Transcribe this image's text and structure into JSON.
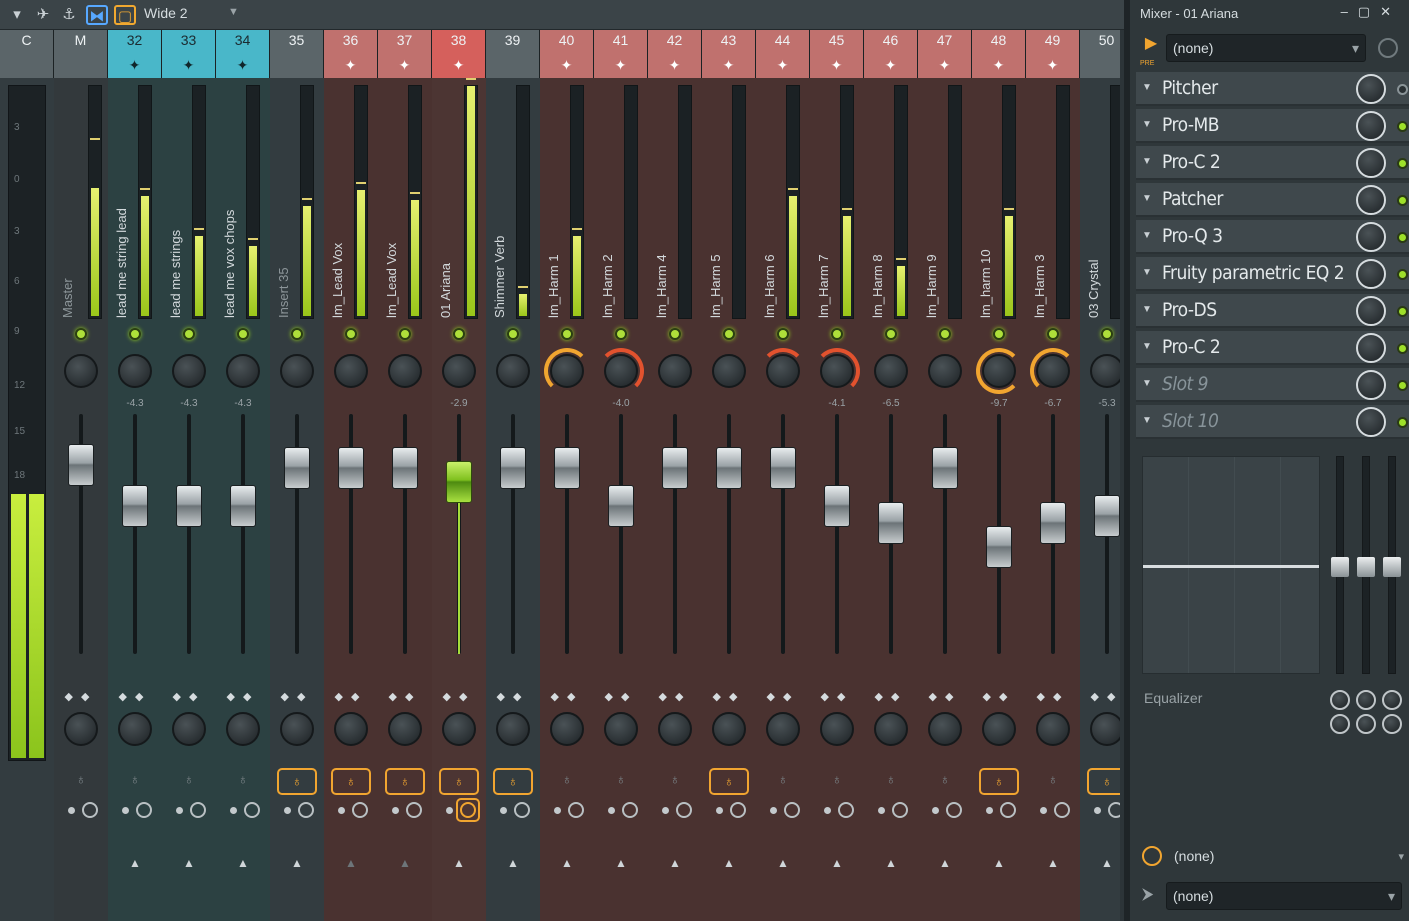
{
  "toolbar": {
    "layout_label": "Wide 2",
    "icons": [
      "menu-arrow-icon",
      "bird-icon",
      "anchor-icon",
      "link-icon",
      "square-icon",
      "dropdown-icon"
    ]
  },
  "window": {
    "title": "Mixer - 01 Ariana",
    "controls": [
      "–",
      "▢",
      "✕"
    ]
  },
  "strip": {
    "master_scale": [
      "3",
      "0",
      "3",
      "6",
      "9",
      "12",
      "15",
      "18"
    ],
    "master_header_c": "C",
    "master_header_m": "M",
    "master_name": "Master",
    "channels": [
      {
        "num": "32",
        "name": "lead me string lead",
        "pan": "-4.3",
        "fader": 0.62,
        "fx_on": false
      },
      {
        "num": "33",
        "name": "lead me strings",
        "pan": "-4.3",
        "fader": 0.62,
        "fx_on": false
      },
      {
        "num": "34",
        "name": "lead me vox chops",
        "pan": "-4.3",
        "fader": 0.62,
        "fx_on": false
      },
      {
        "num": "35",
        "name": "Insert 35",
        "pan": "",
        "fader": 0.78,
        "fx_on": true
      },
      {
        "num": "36",
        "name": "lm_Lead Vox",
        "pan": "",
        "fader": 0.78,
        "fx_on": true
      },
      {
        "num": "37",
        "name": "lm_Lead Vox",
        "pan": "",
        "fader": 0.78,
        "fx_on": true
      },
      {
        "num": "38",
        "name": "01 Ariana",
        "pan": "-2.9",
        "fader": 0.72,
        "fx_on": true
      },
      {
        "num": "39",
        "name": "Shimmer Verb",
        "pan": "",
        "fader": 0.78,
        "fx_on": true
      },
      {
        "num": "40",
        "name": "lm_Harm 1",
        "pan": "",
        "fader": 0.78,
        "fx_on": false
      },
      {
        "num": "41",
        "name": "lm_Harm 2",
        "pan": "-4.0",
        "fader": 0.62,
        "fx_on": false
      },
      {
        "num": "42",
        "name": "lm_Harm 4",
        "pan": "",
        "fader": 0.78,
        "fx_on": false
      },
      {
        "num": "43",
        "name": "lm_Harm 5",
        "pan": "",
        "fader": 0.78,
        "fx_on": true
      },
      {
        "num": "44",
        "name": "lm_Harm 6",
        "pan": "",
        "fader": 0.78,
        "fx_on": false
      },
      {
        "num": "45",
        "name": "lm_Harm 7",
        "pan": "-4.1",
        "fader": 0.62,
        "fx_on": false
      },
      {
        "num": "46",
        "name": "lm_Harm 8",
        "pan": "-6.5",
        "fader": 0.55,
        "fx_on": false
      },
      {
        "num": "47",
        "name": "lm_Harm 9",
        "pan": "",
        "fader": 0.78,
        "fx_on": false
      },
      {
        "num": "48",
        "name": "lm_harm 10",
        "pan": "-9.7",
        "fader": 0.45,
        "fx_on": true
      },
      {
        "num": "49",
        "name": "lm_Harm 3",
        "pan": "-6.7",
        "fader": 0.55,
        "fx_on": false
      },
      {
        "num": "50",
        "name": "03 Crystal",
        "pan": "-5.3",
        "fader": 0.58,
        "fx_on": true
      }
    ]
  },
  "panel": {
    "input_select": "(none)",
    "pre_label": "PRE",
    "slots": [
      {
        "label": "Pitcher",
        "active": false,
        "empty": false
      },
      {
        "label": "Pro-MB",
        "active": true,
        "empty": false
      },
      {
        "label": "Pro-C 2",
        "active": true,
        "empty": false
      },
      {
        "label": "Patcher",
        "active": true,
        "empty": false
      },
      {
        "label": "Pro-Q 3",
        "active": true,
        "empty": false
      },
      {
        "label": "Fruity parametric EQ 2",
        "active": true,
        "empty": false
      },
      {
        "label": "Pro-DS",
        "active": true,
        "empty": false
      },
      {
        "label": "Pro-C 2",
        "active": true,
        "empty": false
      },
      {
        "label": "Slot 9",
        "active": true,
        "empty": true
      },
      {
        "label": "Slot 10",
        "active": true,
        "empty": true
      }
    ],
    "eq_label": "Equalizer",
    "output_select": "(none)",
    "send_select": "(none)"
  }
}
